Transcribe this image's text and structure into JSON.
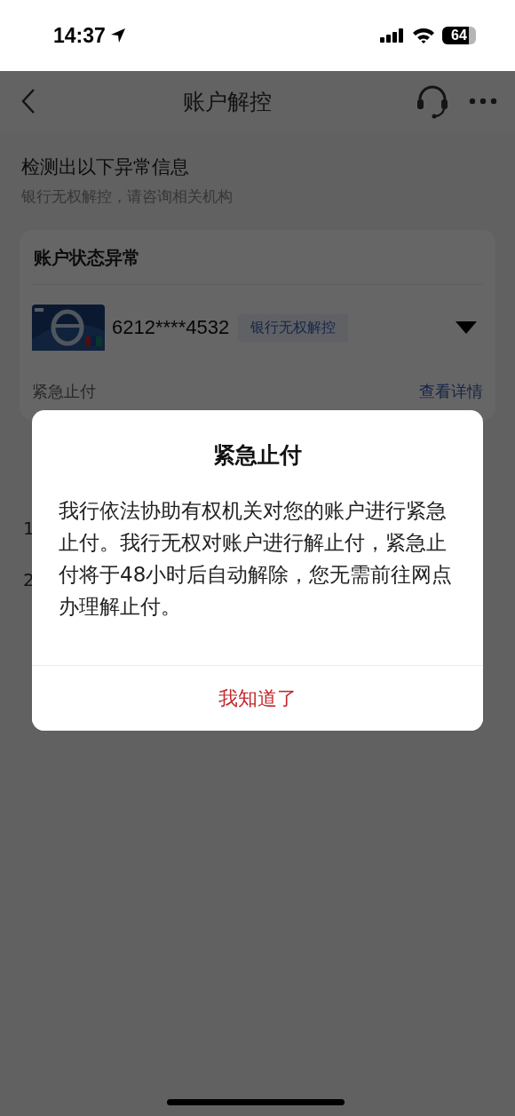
{
  "status_bar": {
    "time": "14:37",
    "battery": "64"
  },
  "header": {
    "title": "账户解控"
  },
  "notice": {
    "title": "检测出以下异常信息",
    "subtitle": "银行无权解控，请咨询相关机构"
  },
  "account_card": {
    "title": "账户状态异常",
    "card_number": "6212****4532",
    "tag": "银行无权解控",
    "status": "紧急止付",
    "link": "查看详情"
  },
  "notes": [
    "1",
    "2"
  ],
  "dialog": {
    "title": "紧急止付",
    "message": "我行依法协助有权机关对您的账户进行紧急止付。我行无权对账户进行解止付，紧急止付将于48小时后自动解除，您无需前往网点办理解止付。",
    "button": "我知道了"
  }
}
